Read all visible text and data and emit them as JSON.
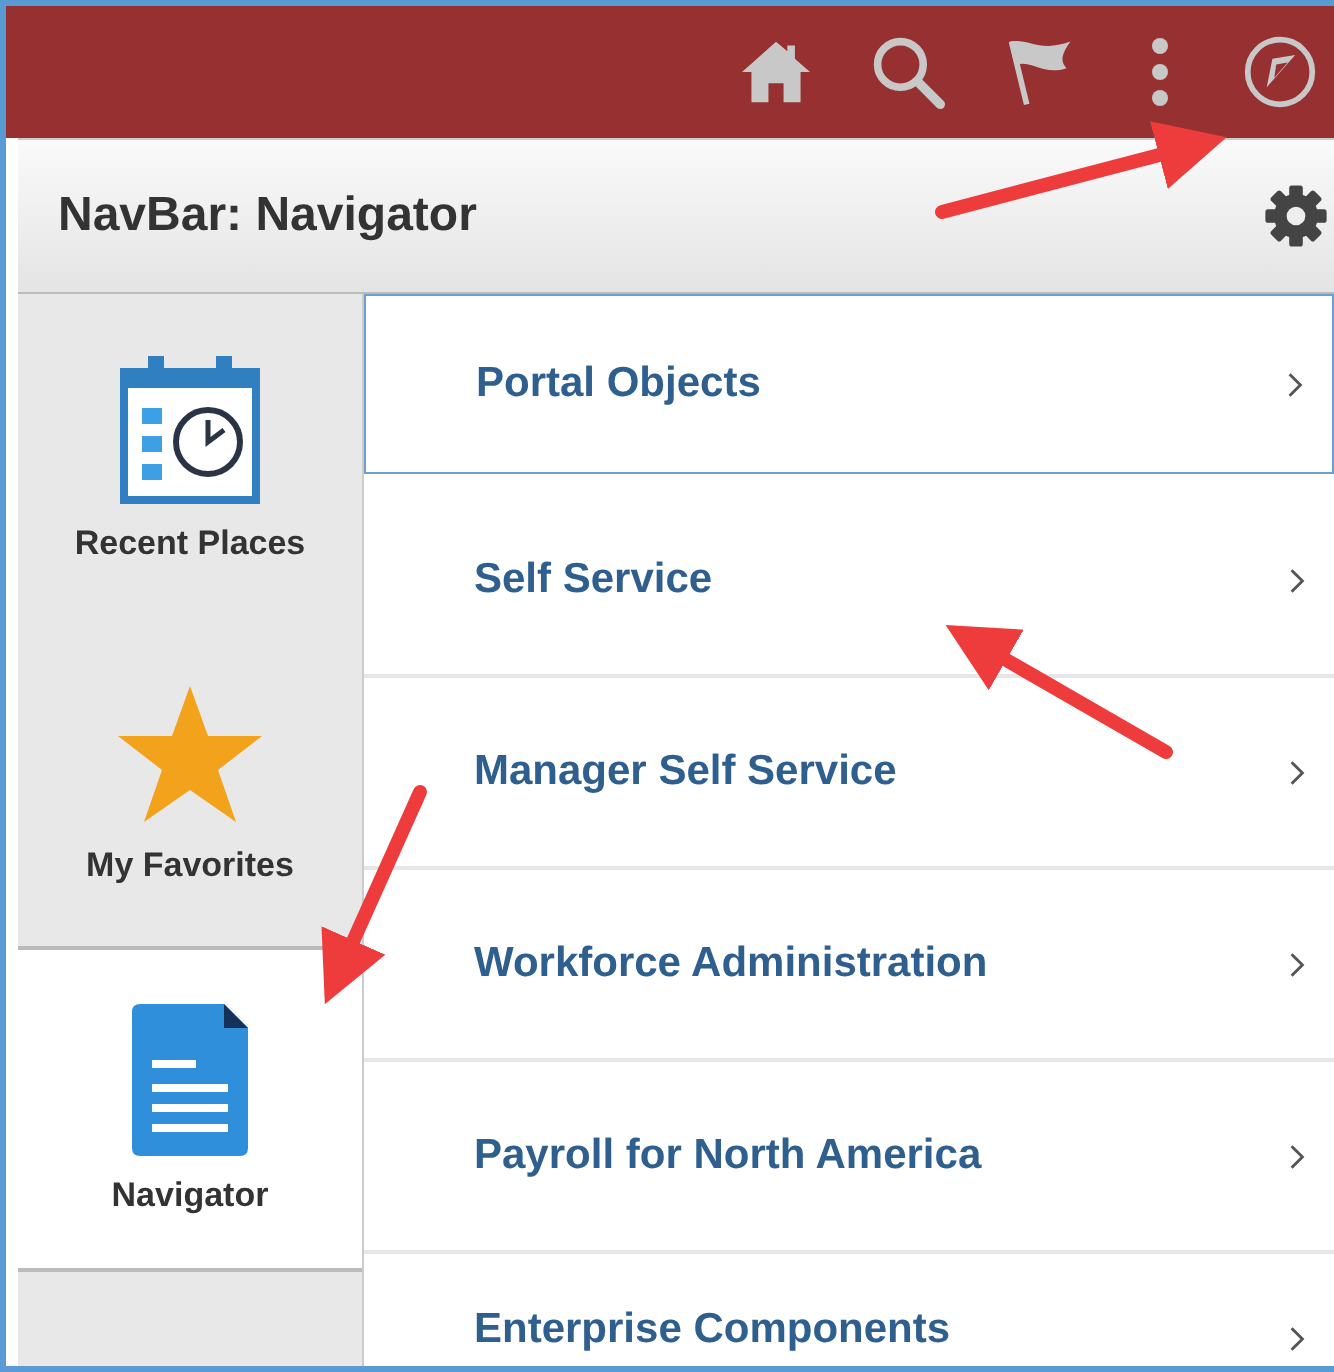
{
  "header": {
    "icons": [
      {
        "kind": "home"
      },
      {
        "kind": "search"
      },
      {
        "kind": "flag"
      },
      {
        "kind": "more"
      },
      {
        "kind": "compass"
      }
    ]
  },
  "title_bar": {
    "title": "NavBar: Navigator"
  },
  "sidebar": {
    "items": [
      {
        "label": "Recent Places",
        "kind": "calendar",
        "selected": false
      },
      {
        "label": "My Favorites",
        "kind": "star",
        "selected": false
      },
      {
        "label": "Navigator",
        "kind": "document",
        "selected": true
      }
    ]
  },
  "menu": {
    "items": [
      {
        "label": "Portal Objects",
        "selected": true
      },
      {
        "label": "Self Service",
        "selected": false
      },
      {
        "label": "Manager Self Service",
        "selected": false
      },
      {
        "label": "Workforce Administration",
        "selected": false
      },
      {
        "label": "Payroll for North America",
        "selected": false
      },
      {
        "label": "Enterprise Components",
        "selected": false
      }
    ]
  }
}
